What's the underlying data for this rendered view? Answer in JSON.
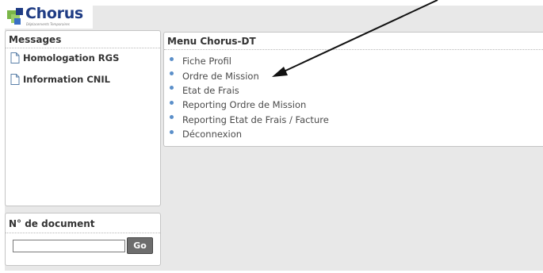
{
  "logo": {
    "text": "Chorus",
    "tagline": "Déplacements Temporaires"
  },
  "messages": {
    "title": "Messages",
    "items": [
      {
        "label": "Homologation RGS",
        "icon": "document-icon"
      },
      {
        "label": "Information CNIL",
        "icon": "document-icon"
      }
    ]
  },
  "menu": {
    "title": "Menu Chorus-DT",
    "items": [
      {
        "label": "Fiche Profil"
      },
      {
        "label": "Ordre de Mission"
      },
      {
        "label": "Etat de Frais"
      },
      {
        "label": "Reporting Ordre de Mission"
      },
      {
        "label": "Reporting Etat de Frais / Facture"
      },
      {
        "label": "Déconnexion"
      }
    ],
    "bullet_color": "#5b8fc9"
  },
  "document_search": {
    "title": "N° de document",
    "input_value": "",
    "go_label": "Go"
  },
  "colors": {
    "background": "#e8e8e8",
    "logo_blue": "#1f3c84",
    "logo_green": "#7ab648",
    "go_button": "#6d6d6d"
  }
}
